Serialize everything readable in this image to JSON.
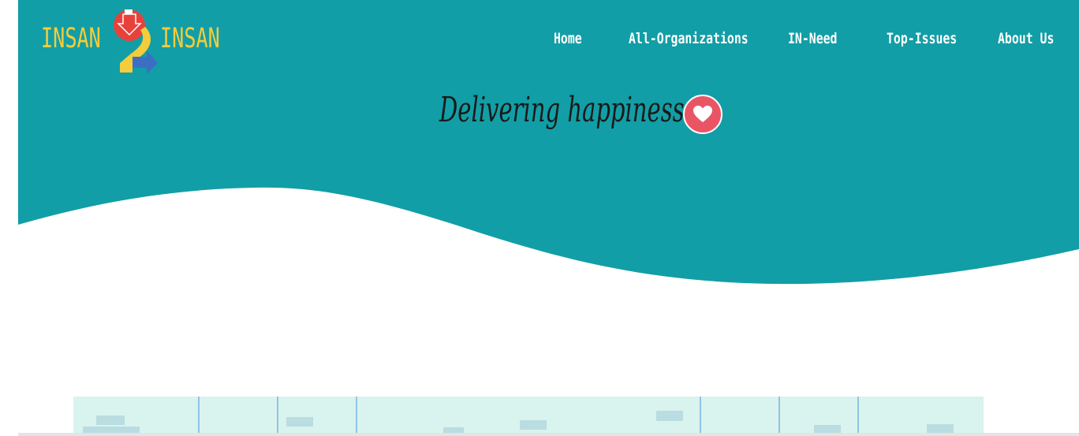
{
  "brand": {
    "word_left": "INSAN",
    "word_right": "INSAN",
    "logo_icon": "two-arrows-icon"
  },
  "nav": {
    "items": [
      {
        "label": "Home"
      },
      {
        "label": "All-Organizations"
      },
      {
        "label": "IN-Need"
      },
      {
        "label": "Top-Issues"
      },
      {
        "label": "About Us"
      }
    ]
  },
  "hero": {
    "headline": "Delivering happiness",
    "badge_icon": "heart-icon"
  },
  "colors": {
    "teal": "#129ea6",
    "logo_yellow": "#f4cc3c",
    "logo_red": "#e8413b",
    "logo_blue": "#3c6fc4",
    "heart_badge": "#ea5565",
    "preview_bg": "#d9f3ee"
  }
}
